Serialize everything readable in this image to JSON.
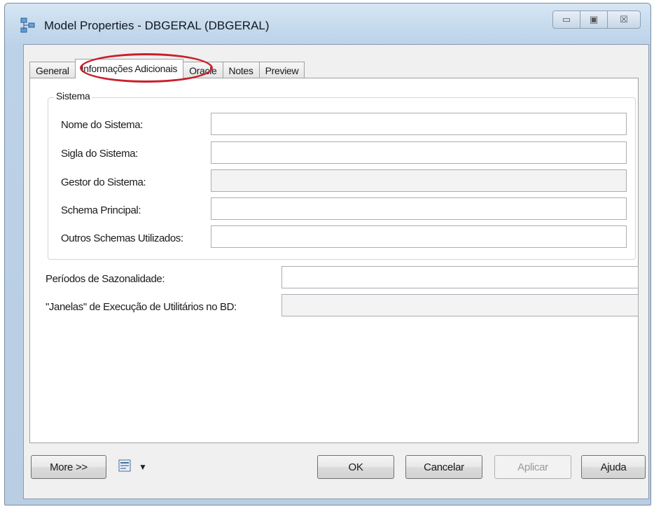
{
  "window": {
    "title": "Model Properties - DBGERAL (DBGERAL)",
    "minimize_icon": "minimize-icon",
    "maximize_icon": "maximize-icon",
    "close_icon": "close-icon",
    "minimize_glyph": "▭",
    "maximize_glyph": "▣",
    "close_glyph": "☒"
  },
  "tabs": [
    {
      "label": "General"
    },
    {
      "label": "Informações Adicionais",
      "active": true
    },
    {
      "label": "Oracle"
    },
    {
      "label": "Notes"
    },
    {
      "label": "Preview"
    }
  ],
  "sistema_group": {
    "title": "Sistema",
    "fields": [
      {
        "label": "Nome do Sistema:",
        "value": ""
      },
      {
        "label": "Sigla do Sistema:",
        "value": ""
      },
      {
        "label": "Gestor do Sistema:",
        "value": ""
      },
      {
        "label": "Schema Principal:",
        "value": ""
      },
      {
        "label": "Outros Schemas Utilizados:",
        "value": ""
      }
    ]
  },
  "extra_fields": [
    {
      "label": "Períodos de Sazonalidade:",
      "value": ""
    },
    {
      "label": "\"Janelas\" de Execução de Utilitários no BD:",
      "value": ""
    }
  ],
  "buttons": {
    "more": "More >>",
    "ok": "OK",
    "cancel": "Cancelar",
    "apply": "Aplicar",
    "help": "Ajuda"
  },
  "icons": {
    "title": "model-properties-icon",
    "toolbar": "properties-menu-icon",
    "dropdown": "chevron-down-icon"
  },
  "colors": {
    "highlight_ring": "#c8202a",
    "frame": "#c3d8ec"
  }
}
